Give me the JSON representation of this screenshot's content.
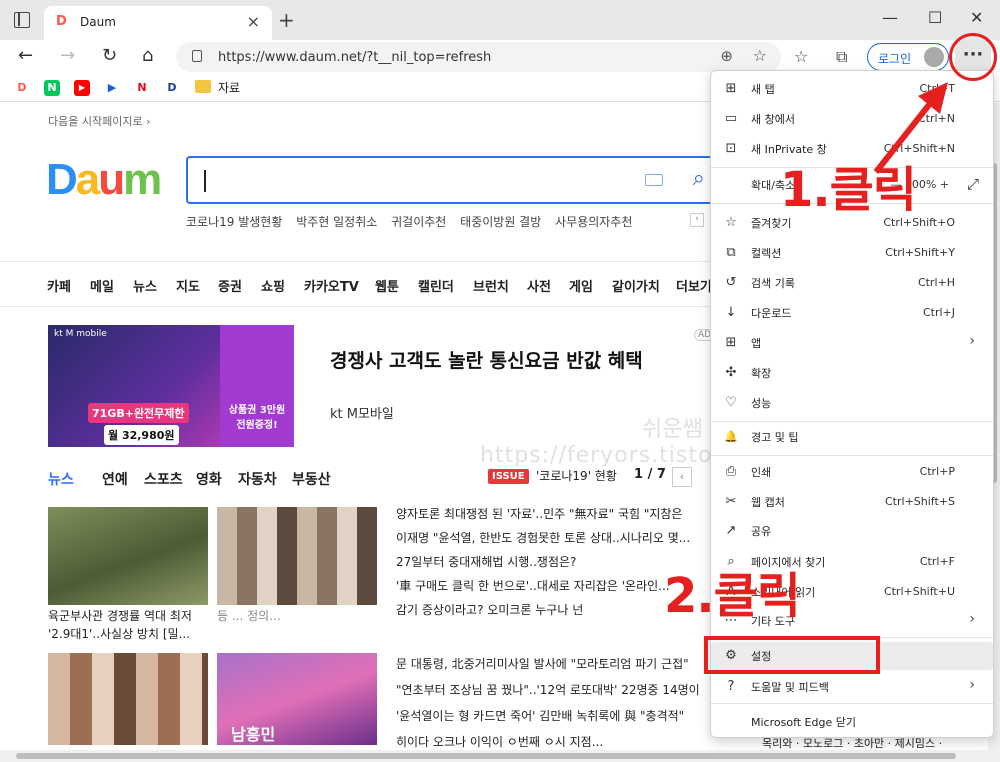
{
  "browser": {
    "tab_title": "Daum",
    "tab_favicon": "D",
    "url": "https://www.daum.net/?t__nil_top=refresh",
    "login_label": "로그인",
    "menu_button": "···",
    "bookmarks": {
      "folder_label": "자료",
      "items": [
        {
          "icon": "daum-bookmark-icon",
          "text": "D",
          "color": "#ff5a4a"
        },
        {
          "icon": "naver-bookmark-icon",
          "text": "N",
          "color": "#03c75a"
        },
        {
          "icon": "youtube-bookmark-icon",
          "text": "▶",
          "color": "#ff0000"
        },
        {
          "icon": "play-bookmark-icon",
          "text": "▶",
          "color": "#1a5fd6"
        },
        {
          "icon": "netflix-bookmark-icon",
          "text": "N",
          "color": "#e50914"
        },
        {
          "icon": "disney-bookmark-icon",
          "text": "D",
          "color": "#1a3ea8"
        }
      ]
    }
  },
  "page": {
    "start_link": "다음을 시작페이지로 ›",
    "logo": [
      "D",
      "a",
      "u",
      "m"
    ],
    "trending": [
      "코로나19 발생현황",
      "박주현 일정취소",
      "귀걸이추천",
      "태중이방원 결방",
      "사무용의자추천"
    ],
    "gnb": [
      "카페",
      "메일",
      "뉴스",
      "지도",
      "증권",
      "쇼핑",
      "카카오TV",
      "웹툰",
      "캘린더",
      "브런치",
      "사전",
      "게임",
      "같이가치",
      "더보기"
    ],
    "ad": {
      "brand": "kt M mobile",
      "badge": "71GB+완전무제한",
      "price": "월 32,980원",
      "box_label": "상품권 3만원 전원증정!",
      "headline": "경쟁사 고객도 놀란 통신요금 반값 혜택",
      "sponsor": "kt M모바일",
      "tag": "AD"
    },
    "news_tabs": [
      "뉴스",
      "연예",
      "스포츠",
      "영화",
      "자동차",
      "부동산"
    ],
    "issue_badge": "ISSUE",
    "issue_text": "'코로나19' 현황",
    "pager": "1 / 7",
    "captions": [
      "육군부사관 경쟁률 역대 최저 '2.9대1'..사실상 방치 [밀...",
      "등 ... 정의..."
    ],
    "news_items": [
      "양자토론 최대쟁점 된 '자료'..민주 \"無자료\" 국힘 \"지참은",
      "이재명 \"윤석열, 한반도 경험못한 토론 상대..시나리오 몇...",
      "27일부터 중대재해법 시행..쟁점은?",
      "'車 구매도 클릭 한 번으로'..대세로 자리잡은 '온라인...",
      "감기 증상이라고? 오미크론 누구나 넌"
    ],
    "news_items2": [
      "문 대통령, 北중거리미사일 발사에 \"모라토리엄 파기 근접\"",
      "\"연초부터 조상님 꿈 꿨나\"..'12억 로또대박' 22명중 14명이",
      "'윤석열이는 형 카드면 죽어' 김만배 녹취록에 與 \"충격적\"",
      "히이다 오크나 이익이 ㅇ번째 ㅇ시 지점..."
    ],
    "right_edge": "목리와 · 모노로그 · 초아만 · 제시밈스 ·",
    "thumb_overlay": "남흥민"
  },
  "menu": {
    "items": [
      {
        "icon": "new-tab-icon",
        "glyph": "⊞",
        "label": "새 탭",
        "shortcut": "Ctrl+T"
      },
      {
        "icon": "new-window-icon",
        "glyph": "▭",
        "label": "새 창에서",
        "shortcut": "Ctrl+N"
      },
      {
        "icon": "inprivate-icon",
        "glyph": "⊡",
        "label": "새 InPrivate 창",
        "shortcut": "Ctrl+Shift+N"
      },
      {
        "icon": "zoom-icon",
        "glyph": "",
        "label": "확대/축소",
        "shortcut": "—  100%  +"
      },
      {
        "icon": "favorites-icon",
        "glyph": "☆",
        "label": "즐겨찾기",
        "shortcut": "Ctrl+Shift+O"
      },
      {
        "icon": "collections-icon",
        "glyph": "⧉",
        "label": "컬렉션",
        "shortcut": "Ctrl+Shift+Y"
      },
      {
        "icon": "history-icon",
        "glyph": "↺",
        "label": "검색 기록",
        "shortcut": "Ctrl+H"
      },
      {
        "icon": "download-icon",
        "glyph": "↓",
        "label": "다운로드",
        "shortcut": "Ctrl+J"
      },
      {
        "icon": "apps-icon",
        "glyph": "⊞",
        "label": "앱",
        "shortcut": ""
      },
      {
        "icon": "extensions-icon",
        "glyph": "✣",
        "label": "확장",
        "shortcut": ""
      },
      {
        "icon": "performance-icon",
        "glyph": "♡",
        "label": "성능",
        "shortcut": ""
      },
      {
        "icon": "alerts-icon",
        "glyph": "🔔",
        "label": "경고 및 팁",
        "shortcut": ""
      },
      {
        "icon": "print-icon",
        "glyph": "⎙",
        "label": "인쇄",
        "shortcut": "Ctrl+P"
      },
      {
        "icon": "web-capture-icon",
        "glyph": "✂",
        "label": "웹 캡처",
        "shortcut": "Ctrl+Shift+S"
      },
      {
        "icon": "share-icon",
        "glyph": "↗",
        "label": "공유",
        "shortcut": ""
      },
      {
        "icon": "find-icon",
        "glyph": "⌕",
        "label": "페이지에서 찾기",
        "shortcut": "Ctrl+F"
      },
      {
        "icon": "read-aloud-icon",
        "glyph": "A",
        "label": "소리내어 읽기",
        "shortcut": "Ctrl+Shift+U"
      },
      {
        "icon": "more-tools-icon",
        "glyph": "⋯",
        "label": "기타 도구",
        "shortcut": ""
      },
      {
        "icon": "settings-icon",
        "glyph": "⚙",
        "label": "설정",
        "shortcut": ""
      },
      {
        "icon": "help-icon",
        "glyph": "?",
        "label": "도움말 및 피드백",
        "shortcut": ""
      },
      {
        "icon": "close-edge-icon",
        "glyph": "",
        "label": "Microsoft Edge 닫기",
        "shortcut": ""
      }
    ]
  },
  "annotations": {
    "step1": "1.클릭",
    "step2": "2.클릭",
    "accent": "#e5201e"
  },
  "watermark": {
    "line1": "쉬운쌤",
    "line2": "https://feryors.tistory.com"
  }
}
